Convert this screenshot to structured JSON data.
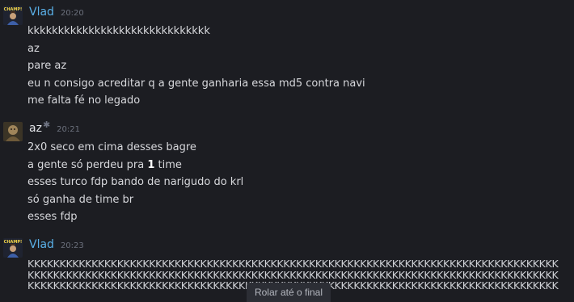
{
  "messages": [
    {
      "author": "Vlad",
      "time": "20:20",
      "avatar_icon": "champion-avatar-icon",
      "avatar_text": "CHAMP!",
      "lines": [
        "kkkkkkkkkkkkkkkkkkkkkkkkkkkkkk",
        "az",
        "pare az",
        "eu n consigo acreditar q a gente ganharia essa md5 contra navi",
        "me falta fé no legado"
      ]
    },
    {
      "author": "az",
      "author_badge": "✱",
      "time": "20:21",
      "avatar_icon": "user-avatar-icon",
      "lines": [
        {
          "pre": "2x0 seco em cima desses bagre"
        },
        {
          "pre": "a gente só perdeu pra ",
          "bold": "1",
          "post": " time"
        },
        {
          "pre": "esses turco fdp bando de narigudo do krl"
        },
        {
          "pre": "só ganha de time br"
        },
        {
          "pre": "esses fdp"
        }
      ]
    },
    {
      "author": "Vlad",
      "time": "20:23",
      "avatar_icon": "champion-avatar-icon",
      "avatar_text": "CHAMP!",
      "lines": [
        "KKKKKKKKKKKKKKKKKKKKKKKKKKKKKKKKKKKKKKKKKKKKKKKKKKKKKKKKKKKKKKKKKKKKKKKKKKKKKKKKKKK",
        "KKKKKKKKKKKKKKKKKKKKKKKKKKKKKKKKKKKKKKKKKKKKKKKKKKKKKKKKKKKKKKKKKKKKKKKKKKKKKKKKKKK",
        "KKKKKKKKKKKKKKKKKKKKKKKKKKKKKKKKKKKKKKKKKKKKKKKKKKKKKKKKKKKKKKKKKKKKKKKKKKKKKKKKKKK"
      ]
    }
  ],
  "scroll_to_bottom": "Rolar até o final"
}
